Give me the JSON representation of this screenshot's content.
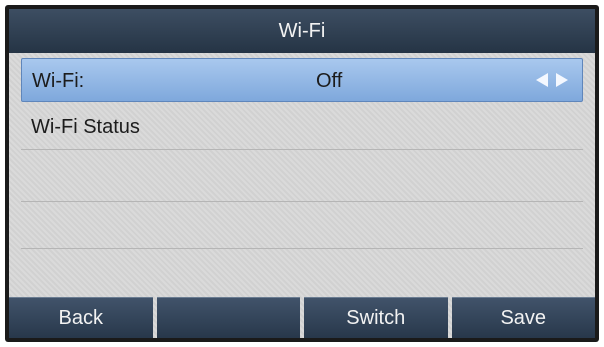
{
  "header": {
    "title": "Wi-Fi"
  },
  "settings": {
    "wifi": {
      "label": "Wi-Fi:",
      "value": "Off"
    },
    "status": {
      "label": "Wi-Fi Status"
    }
  },
  "icons": {
    "prev": "left-triangle-icon",
    "next": "right-triangle-icon"
  },
  "softkeys": [
    "Back",
    "",
    "Switch",
    "Save"
  ],
  "colors": {
    "titlebar": "#2f3f52",
    "selected_row": "#8fb4e4",
    "background": "#d8d8d8",
    "softkey": "#33455a"
  }
}
